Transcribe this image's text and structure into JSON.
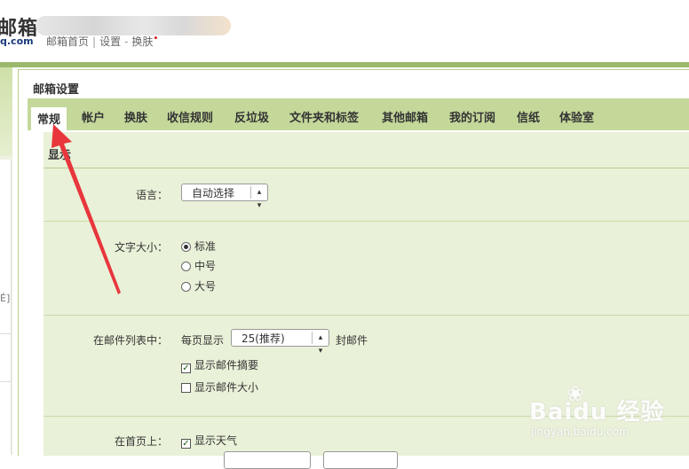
{
  "header": {
    "logo_main": "邮箱",
    "logo_sub": "q.com",
    "links": [
      "邮箱首页",
      "设置",
      "换肤"
    ]
  },
  "panel": {
    "title": "邮箱设置",
    "tabs": [
      {
        "label": "常规",
        "active": true
      },
      {
        "label": "帐户"
      },
      {
        "label": "换肤"
      },
      {
        "label": "收信规则"
      },
      {
        "label": "反垃圾"
      },
      {
        "label": "文件夹和标签"
      },
      {
        "label": "其他邮箱"
      },
      {
        "label": "我的订阅"
      },
      {
        "label": "信纸"
      },
      {
        "label": "体验室"
      }
    ]
  },
  "settings": {
    "section_title": "显示",
    "language": {
      "label": "语言：",
      "value": "自动选择"
    },
    "font_size": {
      "label": "文字大小：",
      "options": [
        {
          "label": "标准",
          "selected": true
        },
        {
          "label": "中号"
        },
        {
          "label": "大号"
        }
      ]
    },
    "mail_list": {
      "label": "在邮件列表中：",
      "per_page_prefix": "每页显示",
      "per_page_value": "25(推荐)",
      "per_page_suffix": "封邮件",
      "show_summary": {
        "label": "显示邮件摘要",
        "checked": true
      },
      "show_size": {
        "label": "显示邮件大小",
        "checked": false
      }
    },
    "home_page": {
      "label": "在首页上：",
      "show_weather": {
        "label": "显示天气",
        "checked": true
      }
    }
  },
  "left": {
    "bracket": "É]"
  },
  "watermark": {
    "logo": "Baidu 经验",
    "url": "jingyan.baidu.com"
  },
  "colors": {
    "accent_green": "#9ab96b",
    "tab_bar": "#c4d89a",
    "content_bg": "#e9f1d8",
    "arrow": "#e8363c"
  }
}
